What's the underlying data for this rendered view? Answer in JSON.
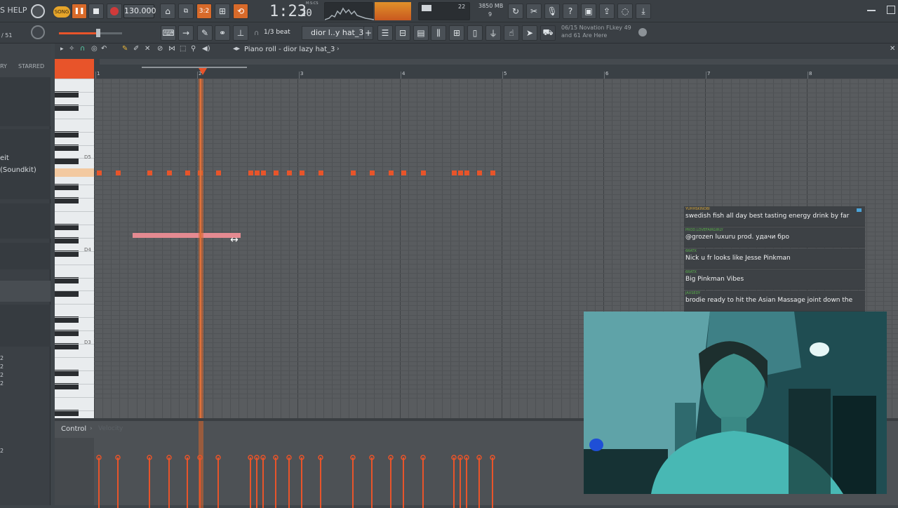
{
  "topbar": {
    "help_label": "S HELP",
    "song_label": "SONG",
    "tempo": "130.000",
    "time": "1:23",
    "time_small": "20",
    "time_unit": "M:S:CS",
    "pattern_label": "3:2",
    "cpu_value": "22",
    "mem_value": "3850 MB",
    "poly_value": "9"
  },
  "toolbar2": {
    "pattern_counter": "/ 51",
    "snap_label": "1/3 beat",
    "pattern_select": "dior l..y hat_3",
    "hint_line1": "06/15  Novation FLkey 49",
    "hint_line2": "and 61 Are Here"
  },
  "browser": {
    "col1": "RY",
    "col2": "STARRED",
    "item1": "eit",
    "item2": "(Soundkit)",
    "nums": [
      "2",
      "2",
      "2",
      "2",
      "2"
    ]
  },
  "pianoroll": {
    "title": "Piano roll - dior lazy hat_3",
    "bars": [
      "1",
      "2",
      "3",
      "4",
      "5",
      "6",
      "7",
      "8"
    ],
    "octaves": [
      "D5",
      "D4",
      "D3"
    ],
    "control_label": "Control",
    "control_sub": "Velocity"
  },
  "chat": [
    {
      "user": "YUHHSKINOBI",
      "user_color": "#d4a53a",
      "text": "swedish fish all day best tasting energy drink by far"
    },
    {
      "user": "PROD.LOVEFAIRGIRLY",
      "user_color": "#5bb04c",
      "text": "@grozen luxuru prod. удачи бро"
    },
    {
      "user": "6RATX",
      "user_color": "#5bb04c",
      "text": "Nick u fr looks like Jesse Pinkman"
    },
    {
      "user": "6RATX",
      "user_color": "#5bb04c",
      "text": "Big Pinkman Vibes"
    },
    {
      "user": "JAXSEDY",
      "user_color": "#5bb04c",
      "text": "brodie ready to hit the Asian Massage joint down the"
    }
  ],
  "colors": {
    "accent": "#e8542a",
    "note": "#e8542a",
    "slide_note": "#e58a91",
    "playhead": "#d9652a"
  },
  "icons": [
    "record-icon",
    "stop-icon",
    "pause-icon",
    "metronome-icon",
    "undo-icon",
    "download-icon",
    "save-icon",
    "help-icon",
    "mic-icon",
    "cut-icon",
    "piano-icon",
    "arrow-icon",
    "pencil-icon",
    "link-icon",
    "speaker-icon",
    "zoom-icon",
    "play-icon"
  ]
}
